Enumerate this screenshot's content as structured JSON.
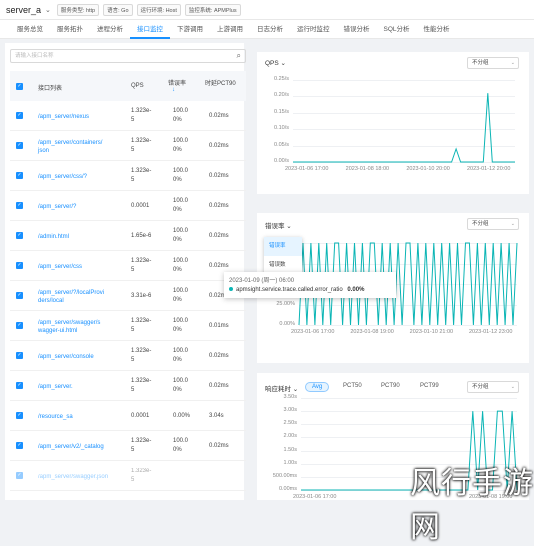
{
  "header": {
    "service_name": "server_a",
    "tags": [
      "服务类型: http",
      "语言: Go",
      "运行环境: Host",
      "监控系统: APMPlus"
    ]
  },
  "tabs": [
    "服务总览",
    "服务拓扑",
    "进程分析",
    "接口监控",
    "下游调用",
    "上游调用",
    "日志分析",
    "运行时监控",
    "错误分析",
    "SQL分析",
    "性能分析"
  ],
  "active_tab": 3,
  "left": {
    "search_placeholder": "请输入接口名称",
    "columns": {
      "endpoint": "接口列表",
      "qps": "QPS",
      "err": "错误率",
      "err_sort": "↓",
      "pct": "时延PCT90"
    },
    "rows": [
      {
        "endpoint_l1": "/apm_server/nexus",
        "endpoint_l2": "",
        "qps_l1": "1.323e-",
        "qps_l2": "5",
        "err_l1": "100.0",
        "err_l2": "0%",
        "pct": "0.02ms"
      },
      {
        "endpoint_l1": "/apm_server/containers/",
        "endpoint_l2": "json",
        "qps_l1": "1.323e-",
        "qps_l2": "5",
        "err_l1": "100.0",
        "err_l2": "0%",
        "pct": "0.02ms"
      },
      {
        "endpoint_l1": "/apm_server/css/?",
        "endpoint_l2": "",
        "qps_l1": "1.323e-",
        "qps_l2": "5",
        "err_l1": "100.0",
        "err_l2": "0%",
        "pct": "0.02ms"
      },
      {
        "endpoint_l1": "/apm_server/?",
        "endpoint_l2": "",
        "qps_l1": "0.0001",
        "qps_l2": "",
        "err_l1": "100.0",
        "err_l2": "0%",
        "pct": "0.02ms"
      },
      {
        "endpoint_l1": "/admin.html",
        "endpoint_l2": "",
        "qps_l1": "1.65e-6",
        "qps_l2": "",
        "err_l1": "100.0",
        "err_l2": "0%",
        "pct": "0.02ms"
      },
      {
        "endpoint_l1": "/apm_server/css",
        "endpoint_l2": "",
        "qps_l1": "1.323e-",
        "qps_l2": "5",
        "err_l1": "100.0",
        "err_l2": "0%",
        "pct": "0.02ms"
      },
      {
        "endpoint_l1": "/apm_server/?/localProvi",
        "endpoint_l2": "ders/local",
        "qps_l1": "3.31e-6",
        "qps_l2": "",
        "err_l1": "100.0",
        "err_l2": "0%",
        "pct": "0.02ms"
      },
      {
        "endpoint_l1": "/apm_server/swagger/s",
        "endpoint_l2": "wagger-ui.html",
        "qps_l1": "1.323e-",
        "qps_l2": "5",
        "err_l1": "100.0",
        "err_l2": "0%",
        "pct": "0.01ms"
      },
      {
        "endpoint_l1": "/apm_server/console",
        "endpoint_l2": "",
        "qps_l1": "1.323e-",
        "qps_l2": "5",
        "err_l1": "100.0",
        "err_l2": "0%",
        "pct": "0.02ms"
      },
      {
        "endpoint_l1": "/apm_server.",
        "endpoint_l2": "",
        "qps_l1": "1.323e-",
        "qps_l2": "5",
        "err_l1": "100.0",
        "err_l2": "0%",
        "pct": "0.02ms"
      },
      {
        "endpoint_l1": "/resource_sa",
        "endpoint_l2": "",
        "qps_l1": "0.0001",
        "qps_l2": "",
        "err_l1": "0.00%",
        "err_l2": "",
        "pct": "3.04s"
      },
      {
        "endpoint_l1": "/apm_server/v2/_catalog",
        "endpoint_l2": "",
        "qps_l1": "1.323e-",
        "qps_l2": "5",
        "err_l1": "100.0",
        "err_l2": "0%",
        "pct": "0.02ms"
      },
      {
        "endpoint_l1": "/apm_server/swagger.json",
        "endpoint_l2": "",
        "qps_l1": "1.323e-",
        "qps_l2": "5",
        "err_l1": "",
        "err_l2": "",
        "pct": ""
      }
    ]
  },
  "qps_panel": {
    "title": "QPS",
    "select": "不分组",
    "chart_data": {
      "type": "line",
      "title": "QPS",
      "y_ticks": [
        "0.25/s",
        "0.20/s",
        "0.15/s",
        "0.10/s",
        "0.05/s",
        "0.00/s"
      ],
      "x_ticks": [
        "2023-01-06 17:00",
        "2023-01-08 18:00",
        "2023-01-10 20:00",
        "2023-01-12 20:00"
      ],
      "ylim": [
        0,
        0.25
      ],
      "series": [
        {
          "values": [
            0,
            0,
            0,
            0,
            0,
            0,
            0,
            0,
            0,
            0,
            0,
            0,
            0,
            0,
            0,
            0,
            0,
            0,
            0,
            0,
            0,
            0,
            0,
            0,
            0,
            0,
            0,
            0,
            0,
            0,
            0,
            0,
            0,
            0,
            0,
            0,
            0.04,
            0,
            0,
            0,
            0,
            0,
            0,
            0.21,
            0,
            0,
            0,
            0,
            0,
            0
          ]
        }
      ]
    }
  },
  "err_panel": {
    "title": "错误率",
    "select": "不分组",
    "dropdown": [
      "错误率",
      "错误数"
    ],
    "tooltip_time": "2023-01-09 (周一) 06:00",
    "tooltip_series": "apmsight.service.trace.called.error_ratio",
    "tooltip_value": "0.00%",
    "chart_data": {
      "type": "line",
      "title": "错误率",
      "y_ticks": [
        "100.00%",
        "75.00%",
        "50.00%",
        "25.00%",
        "0.00%"
      ],
      "x_ticks": [
        "2023-01-06 17:00",
        "2023-01-08 19:00",
        "2023-01-10 21:00",
        "2023-01-12 23:00"
      ],
      "ylim": [
        0,
        100
      ],
      "series": [
        {
          "values": [
            0,
            100,
            0,
            100,
            0,
            100,
            0,
            100,
            0,
            100,
            100,
            0,
            100,
            0,
            100,
            0,
            100,
            0,
            100,
            100,
            0,
            100,
            0,
            100,
            0,
            100,
            0,
            100,
            100,
            0,
            100,
            0,
            100,
            0,
            100,
            0,
            100,
            0,
            100,
            0,
            100,
            0,
            100,
            100,
            0,
            100,
            0,
            100,
            0,
            100,
            0,
            100,
            0,
            100,
            0,
            100
          ]
        }
      ]
    }
  },
  "latency_panel": {
    "title": "响应耗时",
    "pills": [
      "Avg",
      "PCT50",
      "PCT90",
      "PCT99"
    ],
    "active_pill": 0,
    "select": "不分组",
    "chart_data": {
      "type": "line",
      "title": "响应耗时",
      "y_ticks": [
        "3.50s",
        "3.00s",
        "2.50s",
        "2.00s",
        "1.50s",
        "1.00s",
        "500.00ms",
        "0.00ms"
      ],
      "x_ticks": [
        "2023-01-06 17:00",
        "2023-01-08 19:00"
      ],
      "ylim": [
        0,
        3.5
      ],
      "series": [
        {
          "values": [
            0,
            0,
            0,
            0,
            0,
            0,
            0,
            0,
            0,
            0,
            0,
            0,
            0,
            0,
            0,
            0,
            0,
            0,
            0,
            0,
            0,
            0,
            0,
            0,
            0,
            0,
            0,
            0,
            0,
            0,
            0,
            0,
            0,
            0,
            0,
            3.0,
            0,
            3.0,
            0,
            0,
            3.0,
            3.0,
            0,
            3.0,
            0
          ]
        }
      ]
    }
  }
}
